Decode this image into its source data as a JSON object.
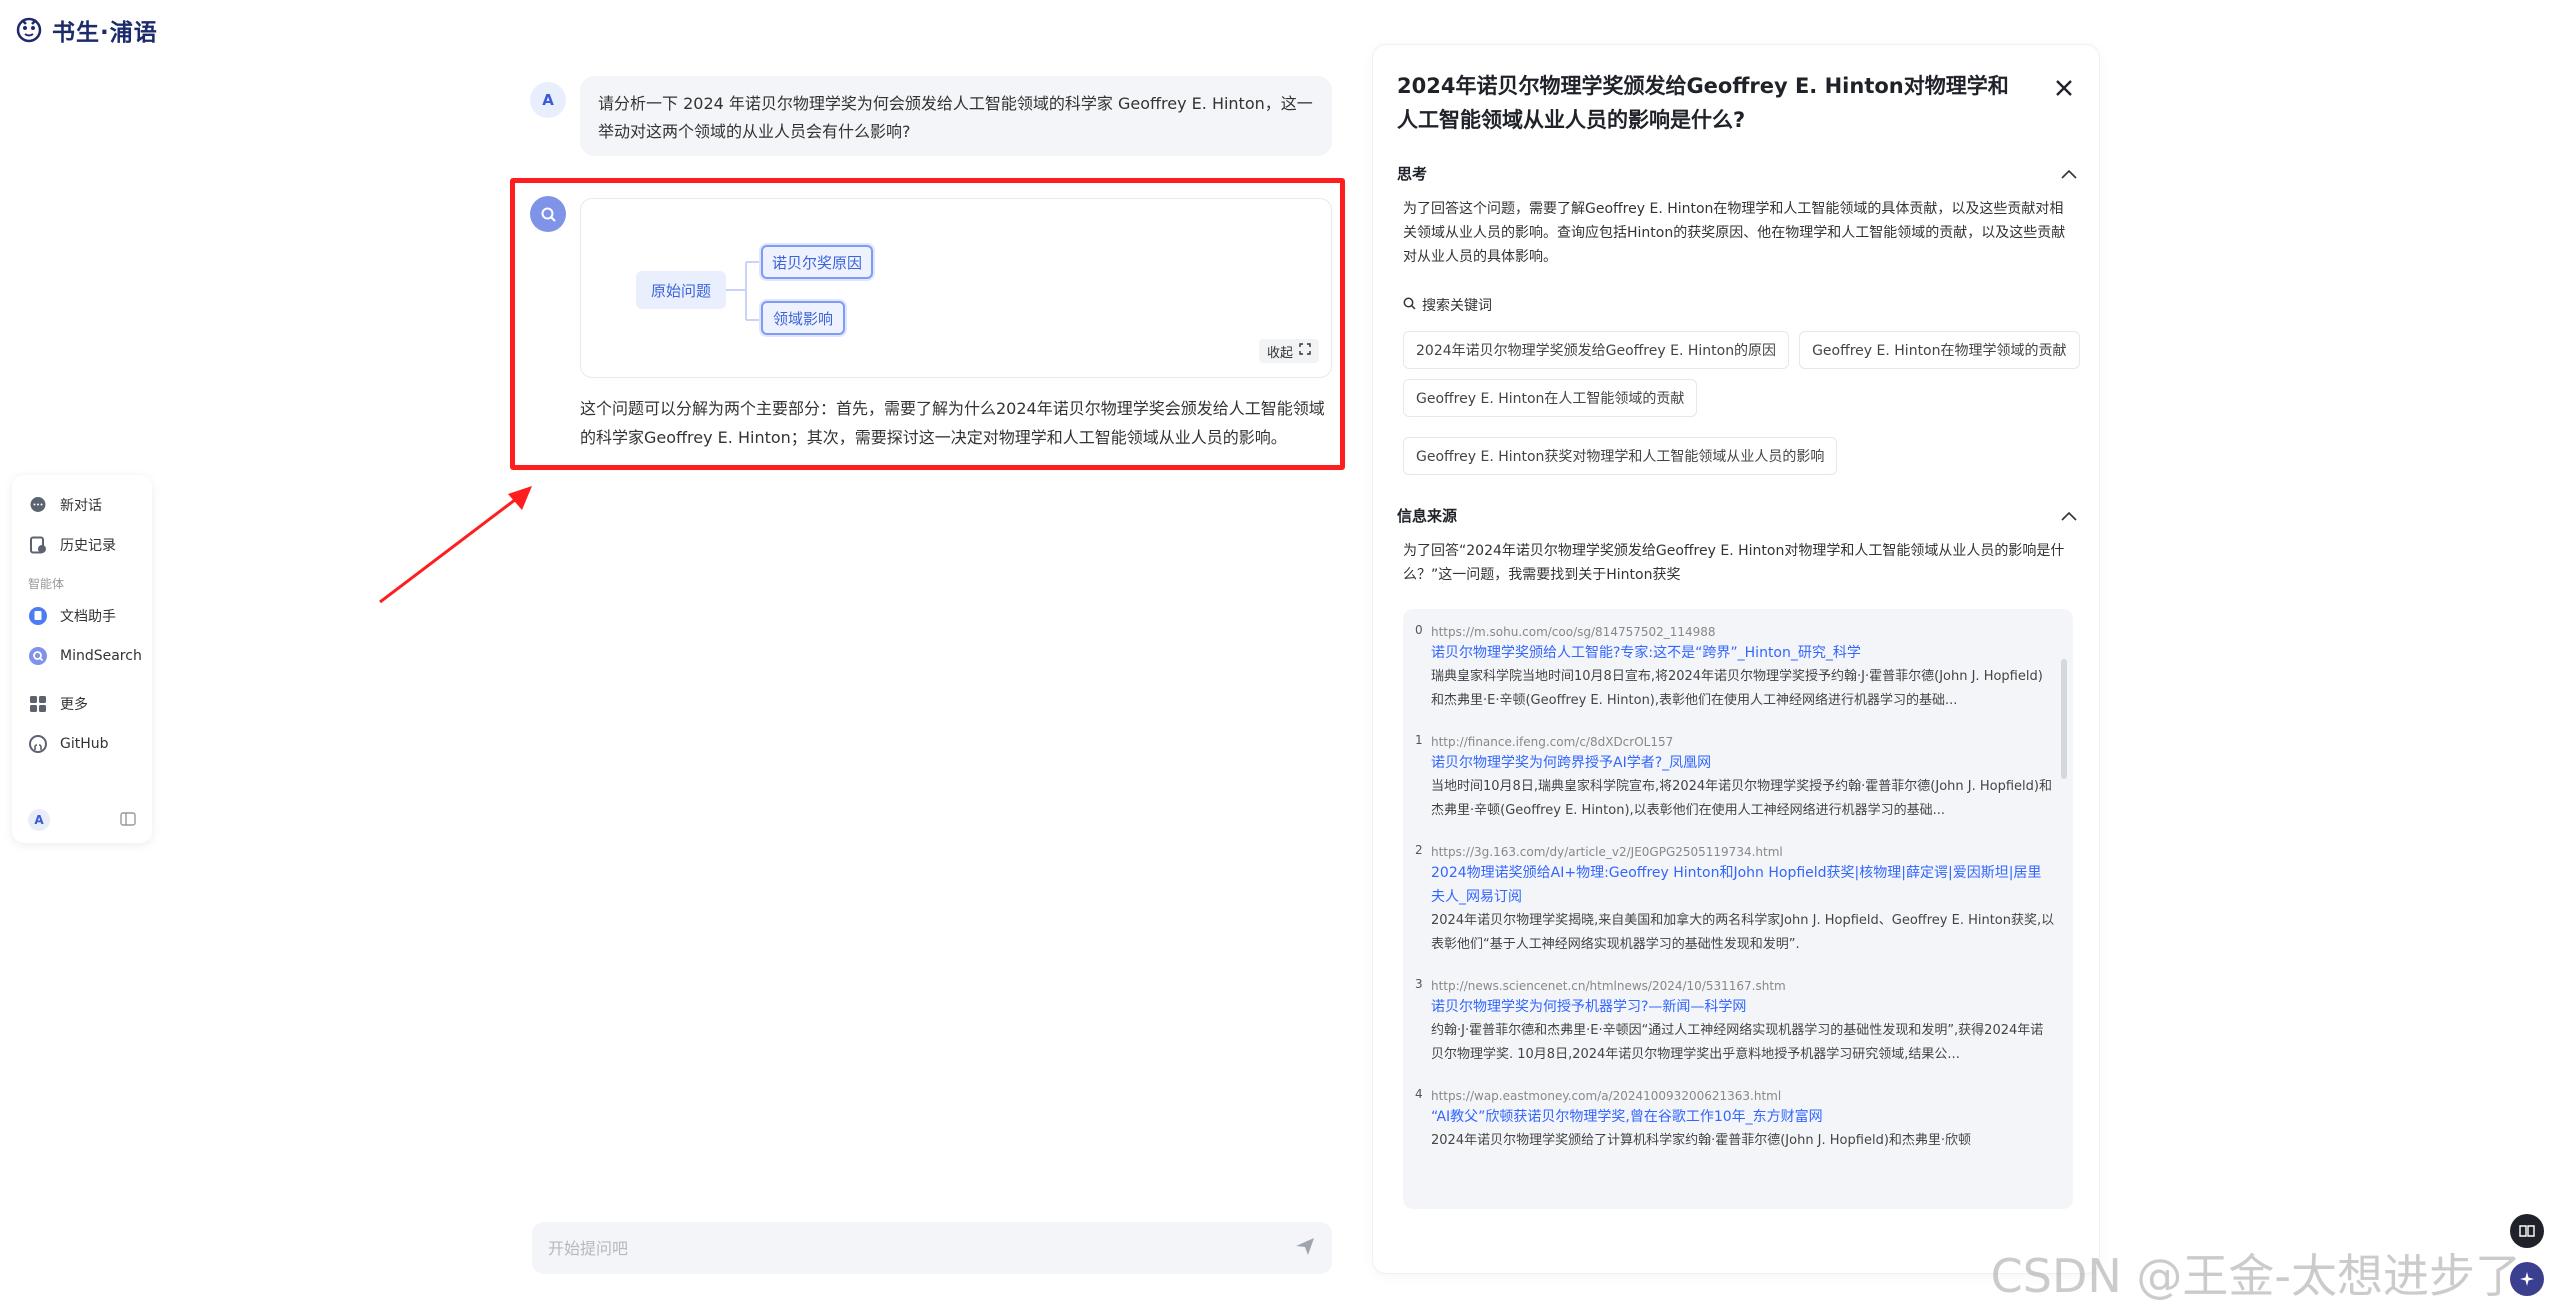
{
  "app": {
    "logo_text": "书生·浦语"
  },
  "sidebar": {
    "new_chat": "新对话",
    "history": "历史记录",
    "section_label": "智能体",
    "doc_assistant": "文档助手",
    "mindsearch": "MindSearch",
    "more": "更多",
    "github": "GitHub",
    "avatar": "A"
  },
  "chat": {
    "user_avatar": "A",
    "user_message": "请分析一下 2024 年诺贝尔物理学奖为何会颁发给人工智能领域的科学家 Geoffrey E. Hinton，这一举动对这两个领域的从业人员会有什么影响?",
    "mindmap": {
      "root": "原始问题",
      "child1": "诺贝尔奖原因",
      "child2": "领域影响",
      "collapse": "收起"
    },
    "bot_message": "这个问题可以分解为两个主要部分：首先，需要了解为什么2024年诺贝尔物理学奖会颁发给人工智能领域的科学家Geoffrey E. Hinton；其次，需要探讨这一决定对物理学和人工智能领域从业人员的影响。",
    "input_placeholder": "开始提问吧"
  },
  "panel": {
    "title": "2024年诺贝尔物理学奖颁发给Geoffrey E. Hinton对物理学和人工智能领域从业人员的影响是什么?",
    "thinking_label": "思考",
    "thinking_text": "为了回答这个问题，需要了解Geoffrey E. Hinton在物理学和人工智能领域的具体贡献，以及这些贡献对相关领域从业人员的影响。查询应包括Hinton的获奖原因、他在物理学和人工智能领域的贡献，以及这些贡献对从业人员的具体影响。",
    "keywords_label": "搜索关键词",
    "keywords": [
      "2024年诺贝尔物理学奖颁发给Geoffrey E. Hinton的原因",
      "Geoffrey E. Hinton在物理学领域的贡献",
      "Geoffrey E. Hinton在人工智能领域的贡献",
      "Geoffrey E. Hinton获奖对物理学和人工智能领域从业人员的影响"
    ],
    "sources_label": "信息来源",
    "sources_intro": "为了回答“2024年诺贝尔物理学奖颁发给Geoffrey E. Hinton对物理学和人工智能领域从业人员的影响是什么？”这一问题，我需要找到关于Hinton获奖",
    "sources": [
      {
        "idx": "0",
        "url": "https://m.sohu.com/coo/sg/814757502_114988",
        "title": "诺贝尔物理学奖颁给人工智能?专家:这不是“跨界”_Hinton_研究_科学",
        "desc": "瑞典皇家科学院当地时间10月8日宣布,将2024年诺贝尔物理学奖授予约翰·J·霍普菲尔德(John J. Hopfield)和杰弗里·E·辛顿(Geoffrey E. Hinton),表彰他们在使用人工神经网络进行机器学习的基础..."
      },
      {
        "idx": "1",
        "url": "http://finance.ifeng.com/c/8dXDcrOL157",
        "title": "诺贝尔物理学奖为何跨界授予AI学者?_凤凰网",
        "desc": "当地时间10月8日,瑞典皇家科学院宣布,将2024年诺贝尔物理学奖授予约翰·霍普菲尔德(John J. Hopfield)和杰弗里·辛顿(Geoffrey E. Hinton),以表彰他们在使用人工神经网络进行机器学习的基础..."
      },
      {
        "idx": "2",
        "url": "https://3g.163.com/dy/article_v2/JE0GPG2505119734.html",
        "title": "2024物理诺奖颁给AI+物理:Geoffrey Hinton和John Hopfield获奖|核物理|薛定谔|爱因斯坦|居里夫人_网易订阅",
        "desc": "2024年诺贝尔物理学奖揭晓,来自美国和加拿大的两名科学家John J. Hopfield、Geoffrey E. Hinton获奖,以表彰他们“基于人工神经网络实现机器学习的基础性发现和发明”."
      },
      {
        "idx": "3",
        "url": "http://news.sciencenet.cn/htmlnews/2024/10/531167.shtm",
        "title": "诺贝尔物理学奖为何授予机器学习?—新闻—科学网",
        "desc": "约翰·J·霍普菲尔德和杰弗里·E·辛顿因“通过人工神经网络实现机器学习的基础性发现和发明”,获得2024年诺贝尔物理学奖. 10月8日,2024年诺贝尔物理学奖出乎意料地授予机器学习研究领域,结果公..."
      },
      {
        "idx": "4",
        "url": "https://wap.eastmoney.com/a/202410093200621363.html",
        "title": "“AI教父”欣顿获诺贝尔物理学奖,曾在谷歌工作10年_东方财富网",
        "desc": "2024年诺贝尔物理学奖颁给了计算机科学家约翰·霍普菲尔德(John J. Hopfield)和杰弗里·欣顿"
      }
    ]
  },
  "watermark": "CSDN @王金-太想进步了",
  "colors": {
    "highlight": "#ff1e1e",
    "accent": "#3c64d8",
    "link": "#3366ff"
  }
}
